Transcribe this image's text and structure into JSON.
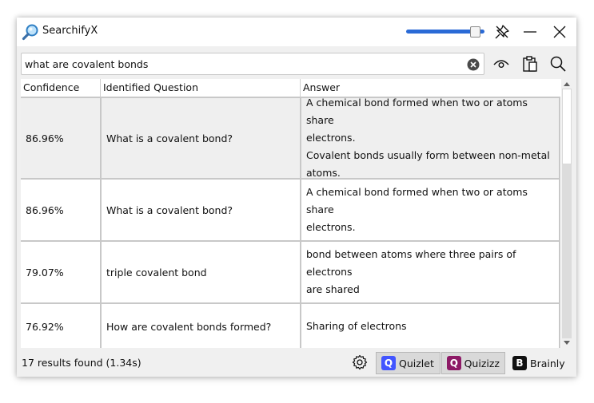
{
  "app": {
    "title": "SearchifyX",
    "opacity_level": 0.93
  },
  "search": {
    "value": "what are covalent bonds",
    "placeholder": ""
  },
  "table": {
    "headers": [
      "Confidence",
      "Identified Question",
      "Answer"
    ],
    "rows": [
      {
        "confidence": "86.96%",
        "question": "What is a covalent bond?",
        "answer": "A chemical bond formed when two or atoms share\nelectrons.\nCovalent bonds usually form between non-metal\natoms.",
        "selected": true
      },
      {
        "confidence": "86.96%",
        "question": "What is a covalent bond?",
        "answer": "A chemical bond formed when two or atoms share\nelectrons.",
        "selected": false
      },
      {
        "confidence": "79.07%",
        "question": "triple covalent bond",
        "answer": "bond between atoms where three pairs of electrons\nare shared",
        "selected": false
      },
      {
        "confidence": "76.92%",
        "question": "How are covalent bonds formed?",
        "answer": "Sharing of electrons",
        "selected": false
      }
    ]
  },
  "status": {
    "results_text": "17 results found (1.34s)"
  },
  "sources": [
    {
      "label": "Quizlet",
      "icon": "quizlet-logo-icon",
      "color": "#4255ff",
      "active": true
    },
    {
      "label": "Quizizz",
      "icon": "quizizz-logo-icon",
      "color": "#8d1a66",
      "active": true
    },
    {
      "label": "Brainly",
      "icon": "brainly-logo-icon",
      "color": "#111111",
      "active": false
    }
  ],
  "colors": {
    "accent": "#2a6ad6",
    "selected_row": "#efefef"
  }
}
